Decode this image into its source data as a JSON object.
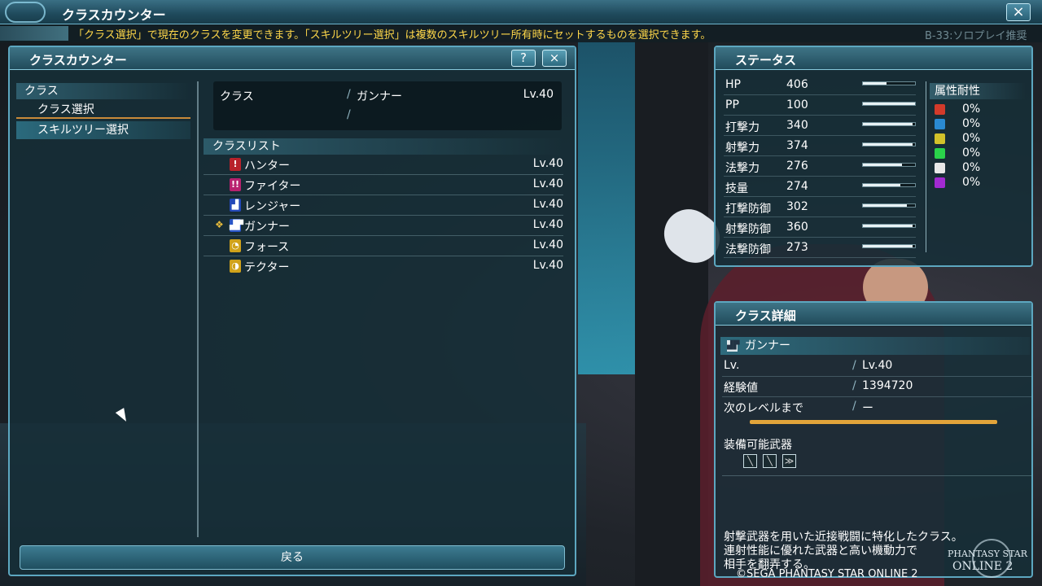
{
  "window": {
    "title": "クラスカウンター",
    "close_icon": "×"
  },
  "hint": {
    "text": "「クラス選択」で現在のクラスを変更できます。「スキルツリー選択」は複数のスキルツリー所有時にセットするものを選択できます。",
    "quest": "B-33:ソロプレイ推奨"
  },
  "counter": {
    "title": "クラスカウンター",
    "help": "?",
    "close": "×",
    "menu": {
      "header": "クラス",
      "items": [
        {
          "label": "クラス選択"
        },
        {
          "label": "スキルツリー選択"
        }
      ]
    },
    "current": {
      "label": "クラス",
      "class": "ガンナー",
      "level": "Lv.40",
      "slash": "/"
    },
    "list_header": "クラスリスト",
    "classes": [
      {
        "name": "ハンター",
        "level": "Lv.40",
        "icon": "!",
        "color": "#b8222b"
      },
      {
        "name": "ファイター",
        "level": "Lv.40",
        "icon": "!!",
        "color": "#b8226f"
      },
      {
        "name": "レンジャー",
        "level": "Lv.40",
        "icon": "▟",
        "color": "#2449b8"
      },
      {
        "name": "ガンナー",
        "level": "Lv.40",
        "icon": "▟▛",
        "color": "#2a56c6",
        "current_mark": "❖"
      },
      {
        "name": "フォース",
        "level": "Lv.40",
        "icon": "◔",
        "color": "#d0a21a"
      },
      {
        "name": "テクター",
        "level": "Lv.40",
        "icon": "◑",
        "color": "#d0a21a"
      }
    ],
    "back_label": "戻る"
  },
  "status": {
    "title": "ステータス",
    "rows": [
      {
        "label": "HP",
        "value": "406",
        "fill": 0.45
      },
      {
        "label": "PP",
        "value": "100",
        "fill": 1.0
      },
      {
        "label": "打撃力",
        "value": "340",
        "fill": 0.95
      },
      {
        "label": "射撃力",
        "value": "374",
        "fill": 0.95
      },
      {
        "label": "法撃力",
        "value": "276",
        "fill": 0.75
      },
      {
        "label": "技量",
        "value": "274",
        "fill": 0.72
      },
      {
        "label": "打撃防御",
        "value": "302",
        "fill": 0.85
      },
      {
        "label": "射撃防御",
        "value": "360",
        "fill": 0.95
      },
      {
        "label": "法撃防御",
        "value": "273",
        "fill": 0.95
      }
    ],
    "resist": {
      "title": "属性耐性",
      "rows": [
        {
          "value": "0%",
          "color": "#d23a2a"
        },
        {
          "value": "0%",
          "color": "#2a8ad2"
        },
        {
          "value": "0%",
          "color": "#d2c22a"
        },
        {
          "value": "0%",
          "color": "#2ad24a"
        },
        {
          "value": "0%",
          "color": "#e8e8e8"
        },
        {
          "value": "0%",
          "color": "#a22ad2"
        }
      ]
    }
  },
  "detail": {
    "title": "クラス詳細",
    "class_name": "ガンナー",
    "rows": [
      {
        "label": "Lv.",
        "value": "Lv.40"
      },
      {
        "label": "経験値",
        "value": "1394720"
      },
      {
        "label": "次のレベルまで",
        "value": "ー"
      }
    ],
    "slash": "/",
    "weapons_label": "装備可能武器",
    "weapons": [
      "sword-icon",
      "rifle-icon",
      "twin-machinegun-icon"
    ],
    "description_lines": [
      "射撃武器を用いた近接戦闘に特化したクラス。",
      "連射性能に優れた武器と高い機動力で",
      "相手を翻弄する。"
    ]
  },
  "copyright": "©SEGA PHANTASY STAR ONLINE 2",
  "logo": {
    "line1": "PHANTASY STAR",
    "line2": "ONLINE 2"
  }
}
